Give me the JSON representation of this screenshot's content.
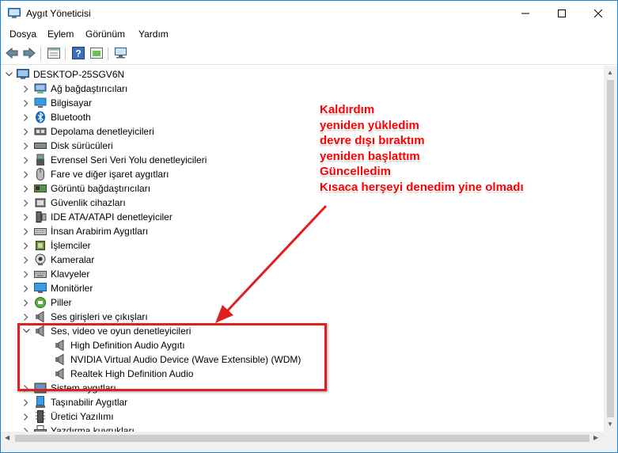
{
  "window": {
    "title": "Aygıt Yöneticisi"
  },
  "menu": [
    "Dosya",
    "Eylem",
    "Görünüm",
    "Yardım"
  ],
  "tree": {
    "root": "DESKTOP-25SGV6N",
    "categories": [
      {
        "label": "Ağ bağdaştırıcıları",
        "icon": "network-adapter-icon"
      },
      {
        "label": "Bilgisayar",
        "icon": "computer-icon"
      },
      {
        "label": "Bluetooth",
        "icon": "bluetooth-icon"
      },
      {
        "label": "Depolama denetleyicileri",
        "icon": "storage-controller-icon"
      },
      {
        "label": "Disk sürücüleri",
        "icon": "disk-drive-icon"
      },
      {
        "label": "Evrensel Seri Veri Yolu denetleyicileri",
        "icon": "usb-icon"
      },
      {
        "label": "Fare ve diğer işaret aygıtları",
        "icon": "mouse-icon"
      },
      {
        "label": "Görüntü bağdaştırıcıları",
        "icon": "display-adapter-icon"
      },
      {
        "label": "Güvenlik cihazları",
        "icon": "security-device-icon"
      },
      {
        "label": "IDE ATA/ATAPI denetleyiciler",
        "icon": "ide-controller-icon"
      },
      {
        "label": "İnsan Arabirim Aygıtları",
        "icon": "hid-icon"
      },
      {
        "label": "İşlemciler",
        "icon": "processor-icon"
      },
      {
        "label": "Kameralar",
        "icon": "camera-icon"
      },
      {
        "label": "Klavyeler",
        "icon": "keyboard-icon"
      },
      {
        "label": "Monitörler",
        "icon": "monitor-icon"
      },
      {
        "label": "Piller",
        "icon": "battery-icon"
      },
      {
        "label": "Ses girişleri ve çıkışları",
        "icon": "audio-io-icon"
      },
      {
        "label": "Ses, video ve oyun denetleyicileri",
        "icon": "sound-controller-icon",
        "expanded": true,
        "children": [
          "High Definition Audio Aygıtı",
          "NVIDIA Virtual Audio Device (Wave Extensible) (WDM)",
          "Realtek High Definition Audio"
        ]
      },
      {
        "label": "Sistem aygıtları",
        "icon": "system-device-icon"
      },
      {
        "label": "Taşınabilir Aygıtlar",
        "icon": "portable-device-icon"
      },
      {
        "label": "Üretici Yazılımı",
        "icon": "firmware-icon"
      },
      {
        "label": "Yazdırma kuyrukları",
        "icon": "print-queue-icon"
      }
    ]
  },
  "annotation": {
    "lines": [
      "Kaldırdım",
      "yeniden yükledim",
      "devre dışı bıraktım",
      "yeniden başlattım",
      "Güncelledim",
      "Kısaca herşeyi denedim yine olmadı"
    ],
    "color": "#ff0000"
  }
}
